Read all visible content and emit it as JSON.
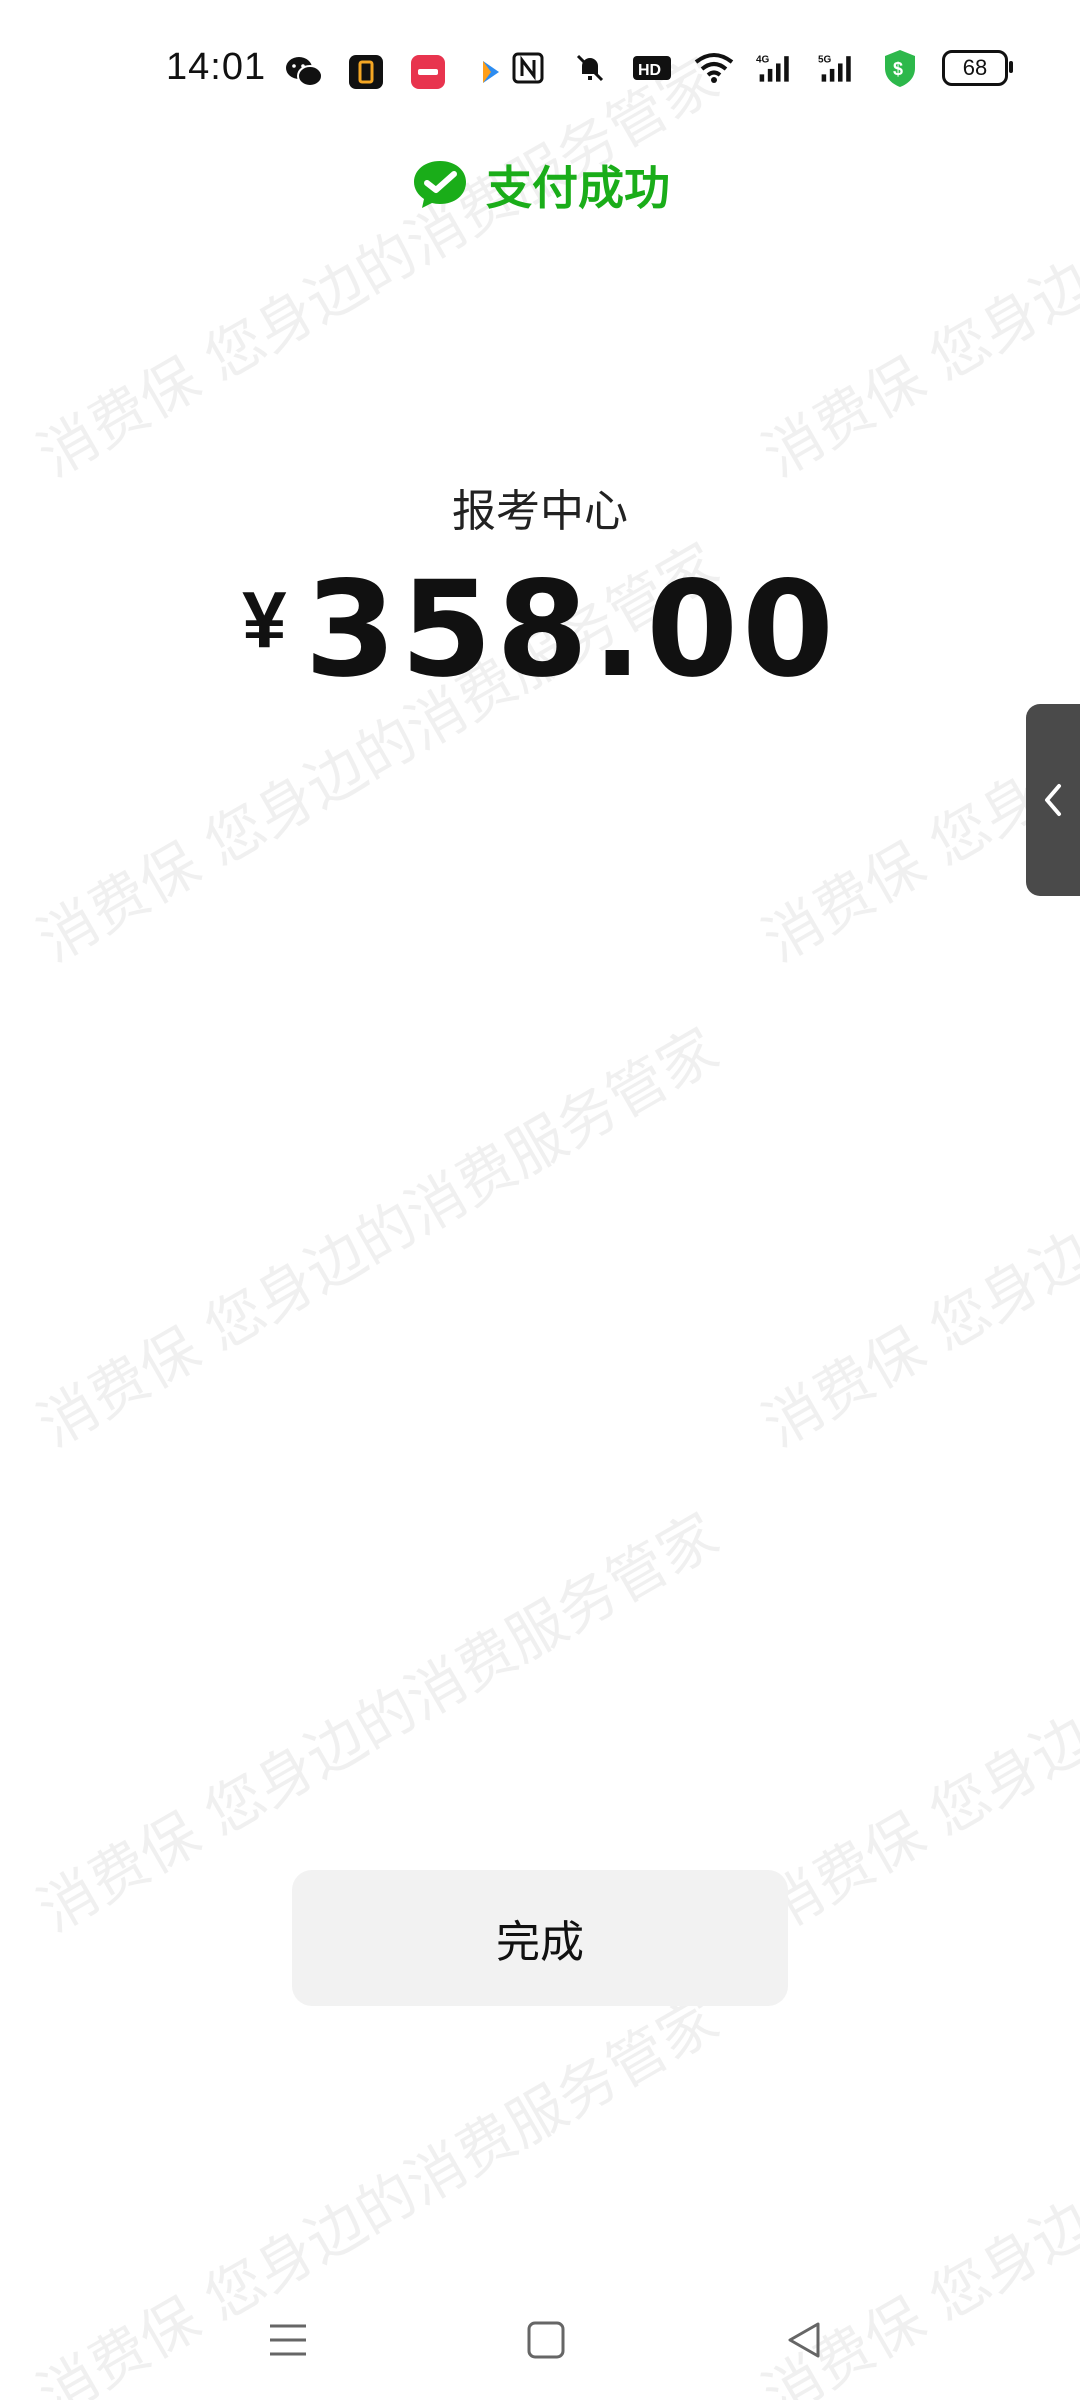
{
  "status_bar": {
    "time": "14:01",
    "app_icons": [
      "wechat-icon",
      "notes-icon",
      "red-app-icon",
      "video-app-icon"
    ],
    "system_icons": [
      "nfc-icon",
      "mute-icon",
      "hd-icon",
      "wifi-icon",
      "signal-4g-icon",
      "signal-5g-icon",
      "security-icon"
    ],
    "battery": "68"
  },
  "header": {
    "title": "支付成功",
    "logo_icon": "wechat-pay-icon",
    "accent_color": "#1aad19"
  },
  "payment": {
    "merchant": "报考中心",
    "currency": "¥",
    "amount": "358.00"
  },
  "actions": {
    "done_label": "完成"
  },
  "nav_bar": {
    "items": [
      "menu-icon",
      "home-icon",
      "back-icon"
    ]
  },
  "watermark": {
    "text": "消费保 您身边的消费服务管家"
  }
}
